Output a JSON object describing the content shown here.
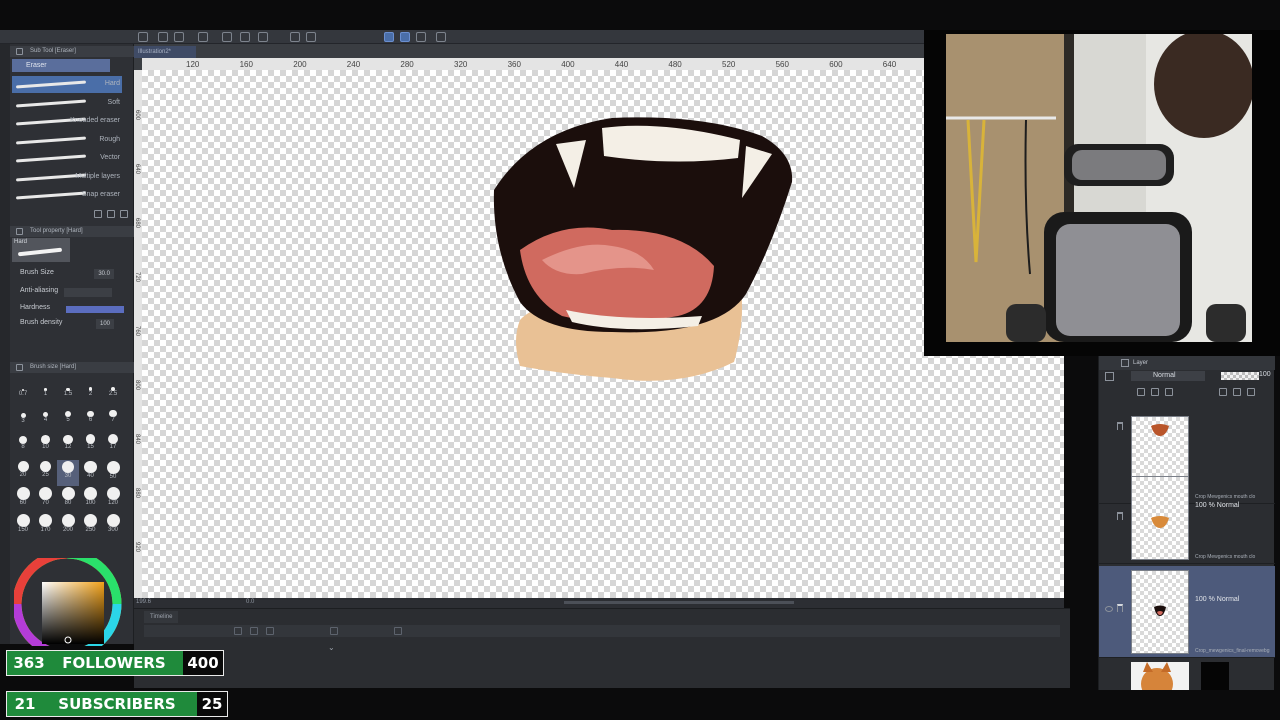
{
  "document": {
    "tab_label": "Illustration2*"
  },
  "sub_tool": {
    "header": "Sub Tool [Eraser]",
    "group": "Eraser",
    "brushes": [
      {
        "label": "Hard",
        "selected": true
      },
      {
        "label": "Soft",
        "selected": false
      },
      {
        "label": "Kneaded eraser",
        "selected": false
      },
      {
        "label": "Rough",
        "selected": false
      },
      {
        "label": "Vector",
        "selected": false
      },
      {
        "label": "Multiple layers",
        "selected": false
      },
      {
        "label": "Snap eraser",
        "selected": false
      }
    ]
  },
  "tool_property": {
    "header": "Tool property [Hard]",
    "preview_label": "Hard",
    "brush_size_label": "Brush Size",
    "brush_size_value": "30.0",
    "anti_aliasing_label": "Anti-aliasing",
    "hardness_label": "Hardness",
    "brush_density_label": "Brush density",
    "brush_density_value": "100"
  },
  "brush_size_panel": {
    "header": "Brush size [Hard]",
    "sizes": [
      "0.7",
      "1",
      "1.5",
      "2",
      "2.5",
      "3",
      "4",
      "5",
      "6",
      "7",
      "8",
      "10",
      "12",
      "15",
      "17",
      "20",
      "25",
      "30",
      "40",
      "50",
      "60",
      "70",
      "80",
      "100",
      "120",
      "150",
      "170",
      "200",
      "250",
      "300"
    ],
    "selected": "30"
  },
  "ruler": {
    "top_ticks": [
      "120",
      "160",
      "200",
      "240",
      "280",
      "320",
      "360",
      "400",
      "440",
      "480",
      "520",
      "560",
      "600",
      "640"
    ],
    "left_ticks": [
      "600",
      "640",
      "680",
      "720",
      "760",
      "800",
      "840",
      "880",
      "920"
    ]
  },
  "canvas_status": {
    "zoom": "199.6",
    "rotation": "0.0"
  },
  "timeline": {
    "header": "Timeline"
  },
  "layer_panel": {
    "tab": "Layer",
    "blend_mode": "Normal",
    "opacity": "100",
    "layers": [
      {
        "mode": "",
        "name": "Crop Mewgenics mouth clo"
      },
      {
        "mode": "100 % Normal",
        "name": "Crop Mewgenics mouth clo"
      },
      {
        "mode": "100 % Normal",
        "name": "Crop_mewgenics_final-removebg"
      }
    ]
  },
  "colors": {
    "accent": "#4a6ea8",
    "counter_green": "#1f8a3b",
    "mouth_dark": "#1b0e0c",
    "tongue": "#d06a5f",
    "skin": "#e9c195"
  },
  "overlay": {
    "followers": {
      "current": "363",
      "label": "FOLLOWERS",
      "goal": "400"
    },
    "subscribers": {
      "current": "21",
      "label": "SUBSCRIBERS",
      "goal": "25"
    }
  }
}
